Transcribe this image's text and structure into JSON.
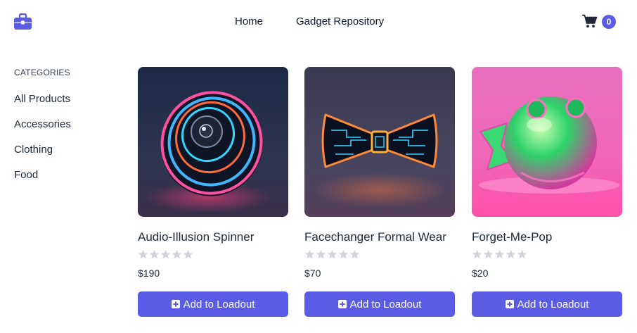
{
  "header": {
    "logo_icon": "briefcase-icon",
    "nav": [
      "Home",
      "Gadget Repository"
    ],
    "cart_icon": "shopping-cart-icon",
    "cart_count": "0",
    "accent": "#5b5ce6"
  },
  "sidebar": {
    "heading": "CATEGORIES",
    "items": [
      "All Products",
      "Accessories",
      "Clothing",
      "Food"
    ]
  },
  "products": [
    {
      "name": "Audio-Illusion Spinner",
      "rating": 0,
      "max_rating": 5,
      "price": "$190",
      "button": "Add to Loadout",
      "button_icon": "plus-square-icon"
    },
    {
      "name": "Facechanger Formal Wear",
      "rating": 0,
      "max_rating": 5,
      "price": "$70",
      "button": "Add to Loadout",
      "button_icon": "plus-square-icon"
    },
    {
      "name": "Forget-Me-Pop",
      "rating": 0,
      "max_rating": 5,
      "price": "$20",
      "button": "Add to Loadout",
      "button_icon": "plus-square-icon"
    }
  ]
}
